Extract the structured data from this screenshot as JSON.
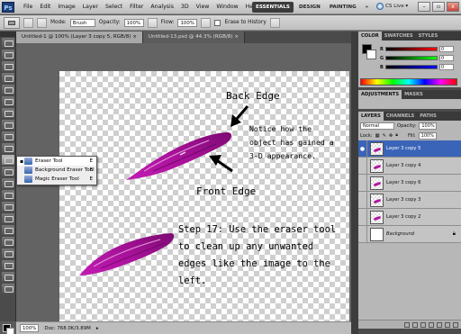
{
  "app": {
    "logo": "Ps"
  },
  "menu": [
    "File",
    "Edit",
    "Image",
    "Layer",
    "Select",
    "Filter",
    "Analysis",
    "3D",
    "View",
    "Window",
    "Help"
  ],
  "workspaces": {
    "essentials": "ESSENTIALS",
    "design": "DESIGN",
    "painting": "PAINTING",
    "more": "»"
  },
  "cslive": "CS Live ▾",
  "window_controls": {
    "minimize": "–",
    "restore": "▫",
    "close": "x"
  },
  "options": {
    "mode_label": "Mode:",
    "mode_value": "Brush",
    "opacity_label": "Opacity:",
    "opacity_value": "100%",
    "flow_label": "Flow:",
    "flow_value": "100%",
    "erase_history": "Erase to History"
  },
  "doc_tabs": [
    "Untitled-1 @ 100% (Layer 3 copy 5, RGB/8) ×",
    "Untitled-13.psd @ 44.3% (RGB/8) ×"
  ],
  "flyout": [
    {
      "label": "Eraser Tool",
      "key": "E"
    },
    {
      "label": "Background Eraser Tool",
      "key": "E"
    },
    {
      "label": "Magic Eraser Tool",
      "key": "E"
    }
  ],
  "annotations": {
    "back_edge": "Back Edge",
    "notice": "Notice how the object has gained a 3-D appearance.",
    "front_edge": "Front Edge",
    "step": "Step 17: Use the eraser tool to clean up any unwanted edges like the image to the left."
  },
  "status": {
    "zoom": "100%",
    "doc": "Doc: 768.0K/3.89M"
  },
  "colors": {
    "stroke": "#a8129a",
    "stroke_dark": "#6e0766",
    "selected_layer": "#3a64b8"
  },
  "color_panel": {
    "tabs": [
      "COLOR",
      "SWATCHES",
      "STYLES"
    ],
    "r": "0",
    "g": "0",
    "b": "0"
  },
  "adjust_panel": {
    "tabs": [
      "ADJUSTMENTS",
      "MASKS"
    ]
  },
  "layers_panel": {
    "tabs": [
      "LAYERS",
      "CHANNELS",
      "PATHS"
    ],
    "blend_mode": "Normal",
    "opacity_label": "Opacity:",
    "opacity_value": "100%",
    "lock_label": "Lock:",
    "fill_label": "Fill:",
    "fill_value": "100%",
    "layers": [
      {
        "name": "Layer 3 copy 5",
        "selected": true
      },
      {
        "name": "Layer 3 copy 4",
        "selected": false
      },
      {
        "name": "Layer 3 copy 6",
        "selected": false
      },
      {
        "name": "Layer 3 copy 3",
        "selected": false
      },
      {
        "name": "Layer 3 copy 2",
        "selected": false
      },
      {
        "name": "Background",
        "selected": false
      }
    ]
  }
}
